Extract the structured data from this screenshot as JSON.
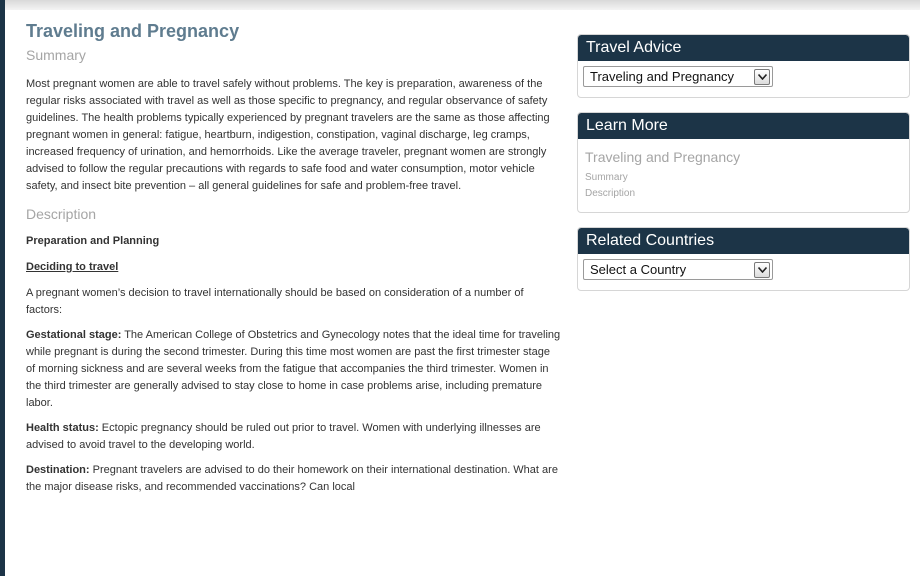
{
  "article": {
    "title": "Traveling and Pregnancy",
    "summary_heading": "Summary",
    "summary_text": "Most pregnant women are able to travel safely without problems. The key is preparation, awareness of the regular risks associated with travel as well as those specific to pregnancy, and regular observance of safety guidelines. The health problems typically experienced by pregnant travelers are the same as those affecting pregnant women in general: fatigue, heartburn, indigestion, constipation, vaginal discharge, leg cramps, increased frequency of urination, and hemorrhoids. Like the average traveler, pregnant women are strongly advised to follow the regular precautions with regards to safe food and water consumption, motor vehicle safety, and insect bite prevention – all general guidelines for safe and problem-free travel.",
    "description_heading": "Description",
    "prep_heading": "Preparation and Planning",
    "deciding_heading": "Deciding to travel",
    "deciding_text": "A pregnant women’s decision to travel internationally should be based on consideration of a number of factors:",
    "gestational_label": "Gestational stage:",
    "gestational_text": " The American College of Obstetrics and Gynecology notes that the ideal time for traveling while pregnant is during the second trimester. During this time most women are past the first trimester stage of morning sickness and are several weeks from the fatigue that accompanies the third trimester. Women in the third trimester are generally advised to stay close to home in case problems arise, including premature labor.",
    "health_label": "Health status:",
    "health_text": " Ectopic pregnancy should be ruled out prior to travel. Women with underlying illnesses are advised to avoid travel to the developing world.",
    "destination_label": "Destination:",
    "destination_text": " Pregnant travelers are advised to do their homework on their international destination. What are the major disease risks, and recommended vaccinations? Can local"
  },
  "sidebar": {
    "travel_advice": {
      "heading": "Travel Advice",
      "selected": "Traveling and Pregnancy"
    },
    "learn_more": {
      "heading": "Learn More",
      "title": "Traveling and Pregnancy",
      "links": [
        "Summary",
        "Description"
      ]
    },
    "related_countries": {
      "heading": "Related Countries",
      "selected": "Select a Country"
    }
  },
  "colors": {
    "panel_header": "#1c3447",
    "title": "#5f7c8f",
    "muted_heading": "#a5a5a5"
  },
  "icons": {
    "select_arrow": "chevron-down-icon"
  }
}
